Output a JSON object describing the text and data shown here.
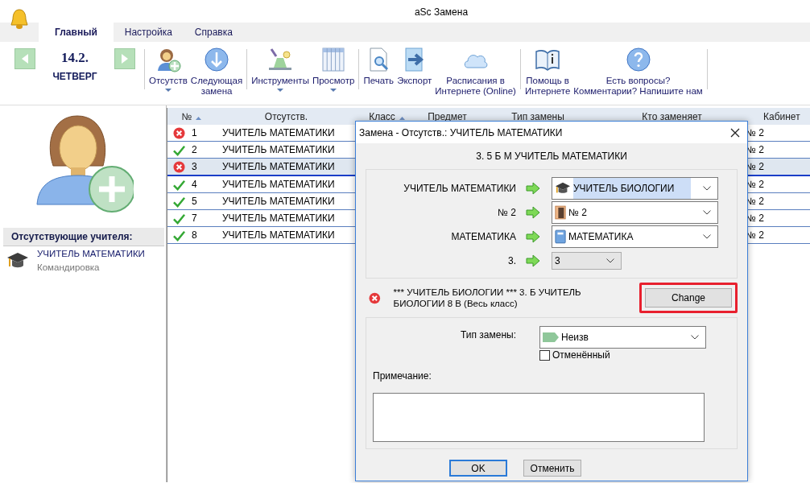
{
  "window": {
    "title": "aSc Замена"
  },
  "tabs": [
    {
      "label": "Главный",
      "selected": true
    },
    {
      "label": "Настройка",
      "selected": false
    },
    {
      "label": "Справка",
      "selected": false
    }
  ],
  "date": {
    "day": "14.2.",
    "weekday": "ЧЕТВЕРГ"
  },
  "ribbon": [
    [
      {
        "kind": "absence",
        "lines": [
          "Отсутств"
        ],
        "dropdown": true
      },
      {
        "kind": "next",
        "lines": [
          "Следующая",
          "замена"
        ],
        "dropdown": false
      }
    ],
    [
      {
        "kind": "tools",
        "lines": [
          "Инструменты"
        ],
        "dropdown": true
      },
      {
        "kind": "view",
        "lines": [
          "Просмотр"
        ],
        "dropdown": true
      }
    ],
    [
      {
        "kind": "print",
        "lines": [
          "Печать"
        ],
        "dropdown": false
      },
      {
        "kind": "export",
        "lines": [
          "Экспорт"
        ],
        "dropdown": false
      },
      {
        "kind": "online",
        "lines": [
          "Расписания в",
          "Интернете (Online)"
        ],
        "dropdown": false
      }
    ],
    [
      {
        "kind": "help",
        "lines": [
          "Помощь в",
          "Интернете"
        ],
        "dropdown": false
      },
      {
        "kind": "feedback",
        "lines": [
          "Есть вопросы?",
          "Комментарии? Напишите нам"
        ],
        "dropdown": false
      }
    ]
  ],
  "left_panel": {
    "section_title": "Отсутствующие учителя:",
    "items": [
      {
        "name": "УЧИТЕЛЬ МАТЕМАТИКИ",
        "reason": "Командировка"
      }
    ]
  },
  "table": {
    "columns": [
      {
        "label": "№",
        "sorted": true
      },
      {
        "label": "Отсутств.",
        "sorted": false
      },
      {
        "label": "Класс",
        "sorted": true
      },
      {
        "label": "Предмет",
        "sorted": false
      },
      {
        "label": "Тип замены",
        "sorted": false
      },
      {
        "label": "Кто заменяет",
        "sorted": false
      },
      {
        "label": "Кабинет",
        "sorted": false
      }
    ],
    "rows": [
      {
        "conflict": true,
        "number": "1",
        "absent": "УЧИТЕЛЬ МАТЕМАТИКИ",
        "room": "№ 2",
        "selected": false
      },
      {
        "conflict": false,
        "number": "2",
        "absent": "УЧИТЕЛЬ МАТЕМАТИКИ",
        "room": "№ 2",
        "selected": false
      },
      {
        "conflict": true,
        "number": "3",
        "absent": "УЧИТЕЛЬ МАТЕМАТИКИ",
        "room": "№ 2",
        "selected": true
      },
      {
        "conflict": false,
        "number": "4",
        "absent": "УЧИТЕЛЬ МАТЕМАТИКИ",
        "room": "№ 2",
        "selected": false
      },
      {
        "conflict": false,
        "number": "5",
        "absent": "УЧИТЕЛЬ МАТЕМАТИКИ",
        "room": "№ 2",
        "selected": false
      },
      {
        "conflict": false,
        "number": "7",
        "absent": "УЧИТЕЛЬ МАТЕМАТИКИ",
        "room": "№ 2",
        "selected": false
      },
      {
        "conflict": false,
        "number": "8",
        "absent": "УЧИТЕЛЬ МАТЕМАТИКИ",
        "room": "№ 2",
        "selected": false
      }
    ]
  },
  "dialog": {
    "title": "Замена - Отсутств.: УЧИТЕЛЬ МАТЕМАТИКИ",
    "summary": "3. 5 Б  М УЧИТЕЛЬ МАТЕМАТИКИ",
    "fields": [
      {
        "kind": "teacher",
        "label": "УЧИТЕЛЬ МАТЕМАТИКИ",
        "value": "УЧИТЕЛЬ БИОЛОГИИ",
        "highlighted": true
      },
      {
        "kind": "room",
        "label": "№ 2",
        "value": "№ 2",
        "highlighted": false
      },
      {
        "kind": "subject",
        "label": "МАТЕМАТИКА",
        "value": "МАТЕМАТИКА",
        "highlighted": false
      },
      {
        "kind": "period",
        "label": "3.",
        "value": "3",
        "highlighted": false
      }
    ],
    "conflict": {
      "text": "*** УЧИТЕЛЬ БИОЛОГИИ *** 3. Б УЧИТЕЛЬ БИОЛОГИИ 8 В (Весь класс)",
      "button": "Change",
      "marked": true
    },
    "type": {
      "label": "Тип замены:",
      "value": "Неизв",
      "color": "#8fc79a"
    },
    "cancelled": {
      "label": "Отменённый",
      "checked": false
    },
    "note": {
      "label": "Примечание:"
    },
    "buttons": [
      {
        "label": "OK",
        "default": true
      },
      {
        "label": "Отменить",
        "default": false
      }
    ]
  }
}
